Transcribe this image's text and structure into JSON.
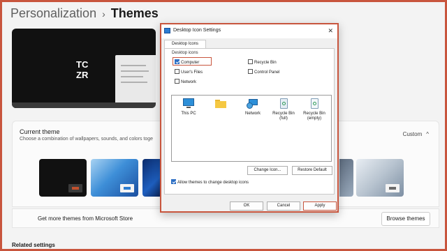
{
  "settings": {
    "breadcrumb_parent": "Personalization",
    "breadcrumb_sep": "›",
    "breadcrumb_current": "Themes",
    "current_theme_title": "Current theme",
    "current_theme_sub": "Choose a combination of wallpapers, sounds, and colors toge",
    "custom_label": "Custom",
    "chevron": "^",
    "store_text": "Get more themes from Microsoft Store",
    "browse_label": "Browse themes",
    "related_settings": "Related settings",
    "preview_logo_line1": "TC",
    "preview_logo_line2": "ZR"
  },
  "dialog": {
    "title": "Desktop Icon Settings",
    "close": "✕",
    "tab": "Desktop Icons",
    "group_label": "Desktop icons",
    "checkboxes": [
      {
        "label": "Computer",
        "checked": true
      },
      {
        "label": "Recycle Bin",
        "checked": false
      },
      {
        "label": "User's Files",
        "checked": false
      },
      {
        "label": "Control Panel",
        "checked": false
      },
      {
        "label": "Network",
        "checked": false
      }
    ],
    "icons": [
      {
        "label": "This PC",
        "icon": "monitor-icon"
      },
      {
        "label": "",
        "icon": "folder-icon"
      },
      {
        "label": "Network",
        "icon": "network-icon"
      },
      {
        "label": "Recycle Bin (full)",
        "icon": "recycle-bin-full-icon"
      },
      {
        "label": "Recycle Bin (empty)",
        "icon": "recycle-bin-empty-icon"
      }
    ],
    "change_icon": "Change Icon...",
    "restore_default": "Restore Default",
    "allow_themes": "Allow themes to change desktop icons",
    "ok": "OK",
    "cancel": "Cancel",
    "apply": "Apply"
  },
  "colors": {
    "highlight": "#c8553d",
    "accent": "#2d6fc4"
  }
}
